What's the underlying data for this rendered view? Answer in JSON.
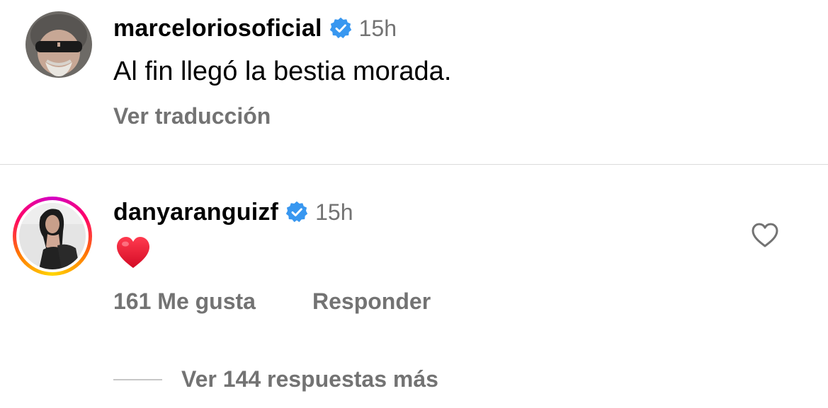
{
  "comments": [
    {
      "username": "marceloriosoficial",
      "verified": true,
      "time": "15h",
      "text": "Al fin llegó la bestia morada.",
      "translate_label": "Ver traducción",
      "avatar": "profile-photo-man-sunglasses"
    },
    {
      "username": "danyaranguizf",
      "verified": true,
      "time": "15h",
      "text_emoji": "red-heart-emoji",
      "likes_label": "161 Me gusta",
      "reply_label": "Responder",
      "avatar": "profile-photo-woman-story-ring",
      "more_replies_label": "Ver 144 respuestas más"
    }
  ],
  "colors": {
    "verified": "#3897f0",
    "secondary_text": "#737373",
    "divider": "#dbdbdb",
    "heart": "#e0112b"
  }
}
